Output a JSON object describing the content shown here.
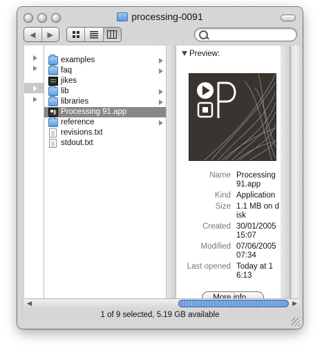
{
  "window": {
    "title": "processing-0091",
    "status": "1 of 9 selected, 5.19 GB available"
  },
  "toolbar": {
    "back_icon": "back-arrow-icon",
    "forward_icon": "forward-arrow-icon",
    "view_modes": [
      "icon-view",
      "list-view",
      "column-view"
    ],
    "active_view": "column-view",
    "search_placeholder": ""
  },
  "columns": {
    "col2_items": [
      {
        "label": "examples",
        "icon": "folder-icon",
        "has_children": true
      },
      {
        "label": "faq",
        "icon": "folder-icon",
        "has_children": true
      },
      {
        "label": "jikes",
        "icon": "executable-icon",
        "has_children": false
      },
      {
        "label": "lib",
        "icon": "folder-icon",
        "has_children": true
      },
      {
        "label": "libraries",
        "icon": "folder-icon",
        "has_children": true
      },
      {
        "label": "Processing 91.app",
        "icon": "app-icon",
        "has_children": false,
        "selected": true
      },
      {
        "label": "reference",
        "icon": "folder-icon",
        "has_children": true
      },
      {
        "label": "revisions.txt",
        "icon": "document-icon",
        "has_children": false
      },
      {
        "label": "stdout.txt",
        "icon": "document-icon",
        "has_children": false
      }
    ]
  },
  "preview": {
    "heading": "Preview:",
    "info": [
      {
        "key": "Name",
        "value": "Processing 91.app"
      },
      {
        "key": "Kind",
        "value": "Application"
      },
      {
        "key": "Size",
        "value": "1.1 MB on disk"
      },
      {
        "key": "Created",
        "value": "30/01/2005 15:07"
      },
      {
        "key": "Modified",
        "value": "07/06/2005 07:34"
      },
      {
        "key": "Last opened",
        "value": "Today at 16:13"
      }
    ],
    "more_info_label": "More info..."
  }
}
